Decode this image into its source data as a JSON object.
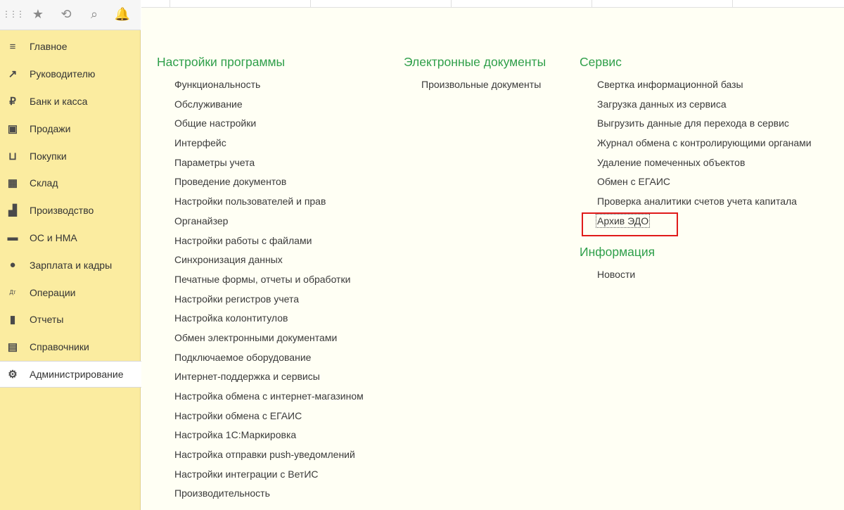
{
  "sidebar": {
    "top_icons": [
      {
        "name": "apps-grid-icon",
        "glyph": "⋮⋮⋮"
      },
      {
        "name": "star-icon",
        "glyph": "★"
      },
      {
        "name": "history-icon",
        "glyph": "⟲"
      },
      {
        "name": "search-icon",
        "glyph": "⌕"
      },
      {
        "name": "bell-icon",
        "glyph": "🔔"
      }
    ],
    "items": [
      {
        "label": "Главное",
        "icon": "menu-lines-icon",
        "glyph": "≡"
      },
      {
        "label": "Руководителю",
        "icon": "trend-up-icon",
        "glyph": "↗"
      },
      {
        "label": "Банк и касса",
        "icon": "ruble-coin-icon",
        "glyph": "₽"
      },
      {
        "label": "Продажи",
        "icon": "shopping-bag-icon",
        "glyph": "▣"
      },
      {
        "label": "Покупки",
        "icon": "cart-icon",
        "glyph": "⊔"
      },
      {
        "label": "Склад",
        "icon": "warehouse-icon",
        "glyph": "▦"
      },
      {
        "label": "Производство",
        "icon": "factory-icon",
        "glyph": "▟"
      },
      {
        "label": "ОС и НМА",
        "icon": "truck-icon",
        "glyph": "▬"
      },
      {
        "label": "Зарплата и кадры",
        "icon": "person-icon",
        "glyph": "●"
      },
      {
        "label": "Операции",
        "icon": "debit-credit-icon",
        "glyph": "Дт"
      },
      {
        "label": "Отчеты",
        "icon": "bar-chart-icon",
        "glyph": "▮"
      },
      {
        "label": "Справочники",
        "icon": "books-icon",
        "glyph": "▤"
      },
      {
        "label": "Администрирование",
        "icon": "gear-icon",
        "glyph": "⚙"
      }
    ],
    "active_item": "Администрирование"
  },
  "columns": [
    {
      "groups": [
        {
          "title": "Настройки программы",
          "links": [
            "Функциональность",
            "Обслуживание",
            "Общие настройки",
            "Интерфейс",
            "Параметры учета",
            "Проведение документов",
            "Настройки пользователей и прав",
            "Органайзер",
            "Настройки работы с файлами",
            "Синхронизация данных",
            "Печатные формы, отчеты и обработки",
            "Настройки регистров учета",
            "Настройка колонтитулов",
            "Обмен электронными документами",
            "Подключаемое оборудование",
            "Интернет-поддержка и сервисы",
            "Настройка обмена с интернет-магазином",
            "Настройки обмена с ЕГАИС",
            "Настройка 1С:Маркировка",
            "Настройка отправки push-уведомлений",
            "Настройки интеграции с ВетИС",
            "Производительность"
          ]
        }
      ]
    },
    {
      "groups": [
        {
          "title": "Электронные документы",
          "links": [
            "Произвольные документы"
          ]
        }
      ]
    },
    {
      "groups": [
        {
          "title": "Сервис",
          "links": [
            "Свертка информационной базы",
            "Загрузка данных из сервиса",
            "Выгрузить данные для перехода в сервис",
            "Журнал обмена с контролирующими органами",
            "Удаление помеченных объектов",
            "Обмен с ЕГАИС",
            "Проверка аналитики счетов учета капитала",
            "Архив ЭДО"
          ]
        },
        {
          "title": "Информация",
          "links": [
            "Новости"
          ]
        }
      ]
    }
  ],
  "highlighted_link": "Архив ЭДО",
  "colors": {
    "sidebar_bg": "#fbeca0",
    "group_title": "#2f9f4a",
    "highlight": "#e01b1b",
    "main_bg": "#fffff4"
  }
}
